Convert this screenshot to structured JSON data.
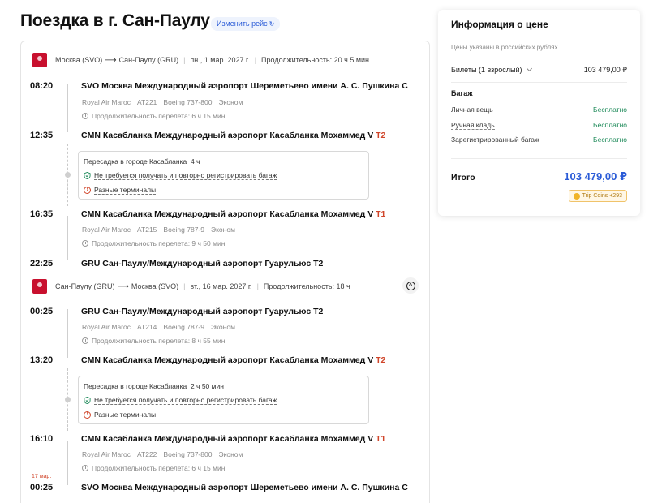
{
  "header": {
    "title": "Поездка в г. Сан-Паулу",
    "change_label": "Изменить рейс"
  },
  "outbound": {
    "from": "Москва (SVO)",
    "to": "Сан-Паулу (GRU)",
    "date": "пн., 1 мар. 2027 г.",
    "duration": "Продолжительность: 20 ч 5 мин",
    "dep1_time": "08:20",
    "dep1_airport": "SVO Москва Международный аэропорт Шереметьево имени А. С. Пушкина C",
    "flight1_airline": "Royal Air Maroc",
    "flight1_number": "AT221",
    "flight1_aircraft": "Boeing 737-800",
    "flight1_class": "Эконом",
    "flight1_duration": "Продолжительность перелета: 6 ч 15 мин",
    "arr1_time": "12:35",
    "arr1_airport": "CMN Касабланка Международный аэропорт Касабланка Мохаммед V",
    "arr1_terminal": "T2",
    "layover_title": "Пересадка в городе Касабланка",
    "layover_duration": "4 ч",
    "layover_baggage": "Не требуется получать и повторно регистрировать багаж",
    "layover_terminals": "Разные терминалы",
    "dep2_time": "16:35",
    "dep2_airport": "CMN Касабланка Международный аэропорт Касабланка Мохаммед V",
    "dep2_terminal": "T1",
    "flight2_airline": "Royal Air Maroc",
    "flight2_number": "AT215",
    "flight2_aircraft": "Boeing 787-9",
    "flight2_class": "Эконом",
    "flight2_duration": "Продолжительность перелета: 9 ч 50 мин",
    "arr2_time": "22:25",
    "arr2_airport": "GRU Сан-Паулу/Международный аэропорт Гуарульюс T2"
  },
  "return": {
    "from": "Сан-Паулу (GRU)",
    "to": "Москва (SVO)",
    "date": "вт., 16 мар. 2027 г.",
    "duration": "Продолжительность: 18 ч",
    "dep1_time": "00:25",
    "dep1_airport": "GRU Сан-Паулу/Международный аэропорт Гуарульюс T2",
    "flight1_airline": "Royal Air Maroc",
    "flight1_number": "AT214",
    "flight1_aircraft": "Boeing 787-9",
    "flight1_class": "Эконом",
    "flight1_duration": "Продолжительность перелета: 8 ч 55 мин",
    "arr1_time": "13:20",
    "arr1_airport": "CMN Касабланка Международный аэропорт Касабланка Мохаммед V",
    "arr1_terminal": "T2",
    "layover_title": "Пересадка в городе Касабланка",
    "layover_duration": "2 ч 50 мин",
    "layover_baggage": "Не требуется получать и повторно регистрировать багаж",
    "layover_terminals": "Разные терминалы",
    "dep2_time": "16:10",
    "dep2_airport": "CMN Касабланка Международный аэропорт Касабланка Мохаммед V",
    "dep2_terminal": "T1",
    "flight2_airline": "Royal Air Maroc",
    "flight2_number": "AT222",
    "flight2_aircraft": "Boeing 737-800",
    "flight2_class": "Эконом",
    "flight2_duration": "Продолжительность перелета: 6 ч 15 мин",
    "arr2_date": "17 мар.",
    "arr2_time": "00:25",
    "arr2_airport": "SVO Москва Международный аэропорт Шереметьево имени А. С. Пушкина C"
  },
  "price": {
    "title": "Информация о цене",
    "note": "Цены указаны в российских рублях",
    "tickets_label": "Билеты (1 взрослый)",
    "tickets_value": "103 479,00 ₽",
    "baggage_title": "Багаж",
    "bag_personal": "Личная вещь",
    "bag_carry": "Ручная кладь",
    "bag_checked": "Зарегистрированный багаж",
    "free": "Бесплатно",
    "total_label": "Итого",
    "total_value": "103 479,00 ₽",
    "coins": "Trip Coins +293"
  },
  "colors": {
    "accent": "#2a5bd7",
    "terminal_red": "#d0452a",
    "free_green": "#1e8a5a",
    "airline_red": "#c8102e"
  }
}
